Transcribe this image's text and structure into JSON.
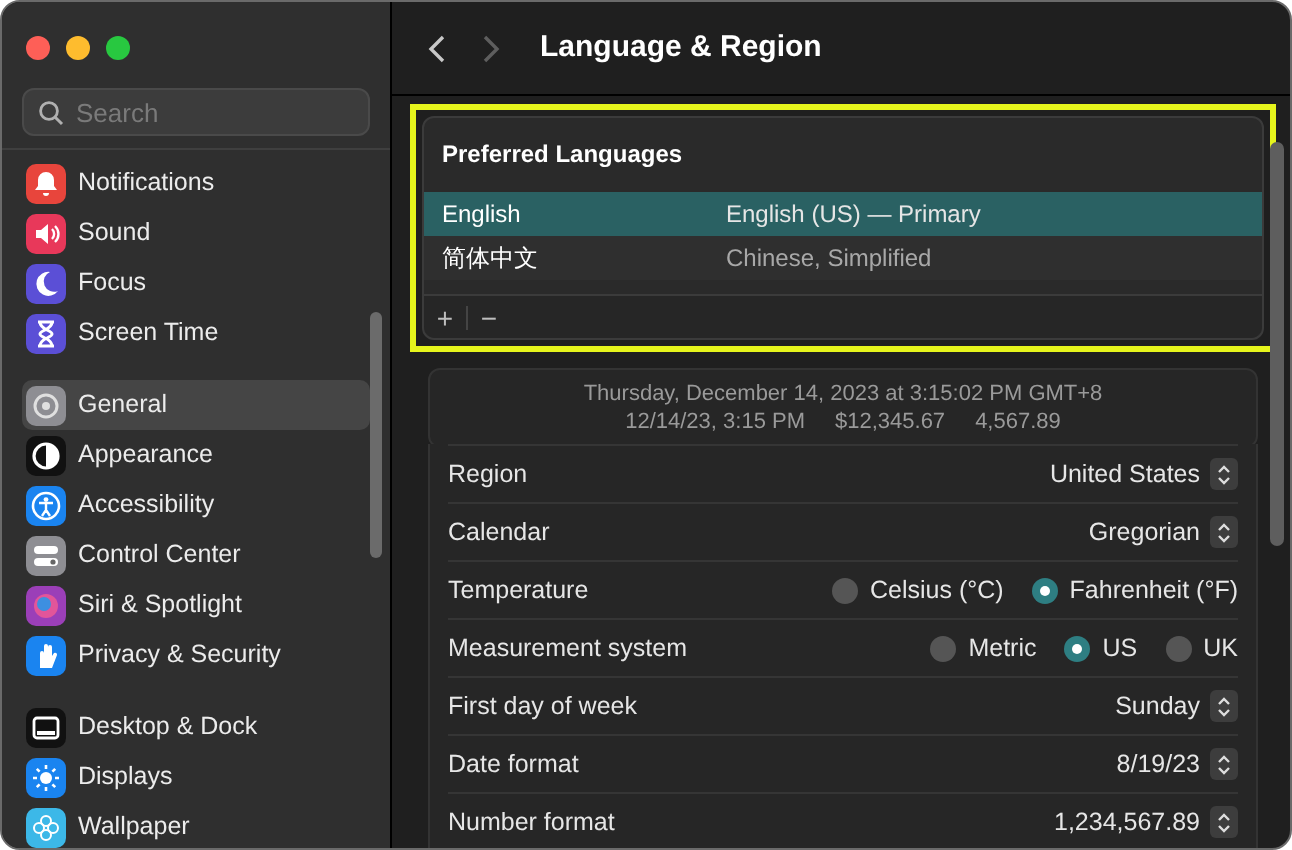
{
  "window": {
    "title": "Language & Region"
  },
  "sidebar": {
    "search": {
      "placeholder": "Search"
    },
    "groups": [
      [
        {
          "label": "Notifications",
          "color": "#e8453c",
          "selected": false
        },
        {
          "label": "Sound",
          "color": "#e8385a",
          "selected": false
        },
        {
          "label": "Focus",
          "color": "#5b4fd6",
          "selected": false
        },
        {
          "label": "Screen Time",
          "color": "#5b4fd6",
          "selected": false
        }
      ],
      [
        {
          "label": "General",
          "color": "#8e8e93",
          "selected": true
        },
        {
          "label": "Appearance",
          "color": "#111111",
          "selected": false
        },
        {
          "label": "Accessibility",
          "color": "#1a84f0",
          "selected": false
        },
        {
          "label": "Control Center",
          "color": "#8e8e93",
          "selected": false
        },
        {
          "label": "Siri & Spotlight",
          "color": "#9b3fb8",
          "selected": false
        },
        {
          "label": "Privacy & Security",
          "color": "#1a84f0",
          "selected": false
        }
      ],
      [
        {
          "label": "Desktop & Dock",
          "color": "#111111",
          "selected": false
        },
        {
          "label": "Displays",
          "color": "#1a84f0",
          "selected": false
        },
        {
          "label": "Wallpaper",
          "color": "#3cb8e8",
          "selected": false
        }
      ]
    ]
  },
  "preferred_languages": {
    "title": "Preferred Languages",
    "languages": [
      {
        "name": "English",
        "description": "English (US) — Primary",
        "selected": true
      },
      {
        "name": "简体中文",
        "description": "Chinese, Simplified",
        "selected": false
      }
    ],
    "buttons": [
      "+",
      "−"
    ]
  },
  "preview": {
    "line_1": "Thursday, December 14, 2023 at 3:15:02 PM GMT+8",
    "line_2": [
      "12/14/23, 3:15 PM",
      "$12,345.67",
      "4,567.89"
    ]
  },
  "settings": [
    {
      "kind": "popup",
      "label": "Region",
      "value": "United States"
    },
    {
      "kind": "popup",
      "label": "Calendar",
      "value": "Gregorian"
    },
    {
      "kind": "radio",
      "label": "Temperature",
      "options": [
        {
          "label": "Celsius (°C)",
          "selected": false
        },
        {
          "label": "Fahrenheit (°F)",
          "selected": true
        }
      ]
    },
    {
      "kind": "radio",
      "label": "Measurement system",
      "options": [
        {
          "label": "Metric",
          "selected": false
        },
        {
          "label": "US",
          "selected": true
        },
        {
          "label": "UK",
          "selected": false
        }
      ]
    },
    {
      "kind": "popup",
      "label": "First day of week",
      "value": "Sunday"
    },
    {
      "kind": "popup",
      "label": "Date format",
      "value": "8/19/23"
    },
    {
      "kind": "popup",
      "label": "Number format",
      "value": "1,234,567.89"
    }
  ]
}
